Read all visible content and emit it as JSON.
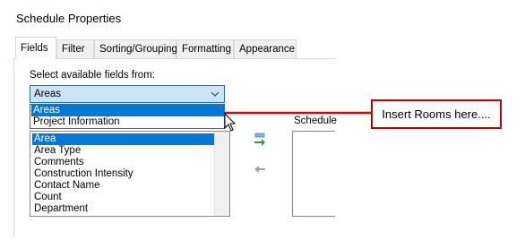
{
  "dialog": {
    "title": "Schedule Properties"
  },
  "tabs": [
    {
      "label": "Fields"
    },
    {
      "label": "Filter"
    },
    {
      "label": "Sorting/Grouping"
    },
    {
      "label": "Formatting"
    },
    {
      "label": "Appearance"
    }
  ],
  "fields_tab": {
    "select_label": "Select available fields from:",
    "combo_value": "Areas",
    "dropdown_options": [
      "Areas",
      "Project Information"
    ],
    "available_fields": [
      "Area",
      "Area Type",
      "Comments",
      "Construction Intensity",
      "Contact Name",
      "Count",
      "Department"
    ],
    "schedule_label": "Schedule"
  },
  "callout": {
    "text": "Insert Rooms here....",
    "color": "#c00000"
  },
  "colors": {
    "selection": "#0078d7",
    "combo_bg": "#cce4f7"
  }
}
